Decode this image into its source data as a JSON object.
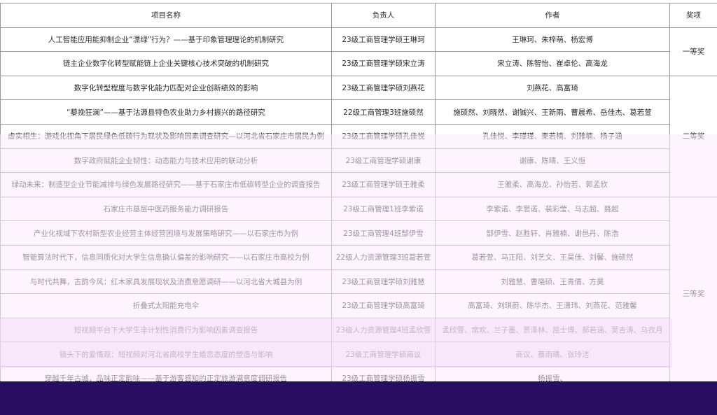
{
  "table": {
    "headers": {
      "name": "项目名称",
      "leader": "负责人",
      "authors": "作者",
      "award": "奖项"
    },
    "award_labels": {
      "first": "一等奖",
      "second": "二等奖",
      "third": "三等奖"
    },
    "rows": [
      {
        "name": "人工智能应用能抑制企业“漂绿”行为？——基于印象管理理论的机制研究",
        "leader": "23级工商管理学硕王琳珂",
        "authors": "王琳珂、朱梓萌、杨宏博"
      },
      {
        "name": "链主企业数字化转型赋能链上企业关键核心技术突破的机制研究",
        "leader": "23级工商管理学硕宋立涛",
        "authors": "宋立涛、陈智怡、崔卓伦、高海龙"
      },
      {
        "name": "数字化转型程度与数字化能力匹配对企业创新绩效的影响",
        "leader": "23级工商管理学硕刘燕花",
        "authors": "刘燕花、高富琦"
      },
      {
        "name": "“藜挽狂澜”——基于沽源县特色农业助力乡村振兴的路径研究",
        "leader": "22级工商管理3班施硕然",
        "authors": "施硕然、刘晓然、谢铖兴、王新雨、曹晨希、岳佳杰、葛若萱"
      },
      {
        "name": "虚实相生：游戏化视角下居民绿色低碳行为现状及影响因素调查研究—以河北省石家庄市居民为例",
        "leader": "23级工商管理学硕孔佳悦",
        "authors": "孔佳悦、李瑾瑾、栗若楠、刘雅楠、杨子涵"
      },
      {
        "name": "数字政府赋能企业韧性：动态能力与技术应用的联动分析",
        "leader": "23级工商管理学硕谢康",
        "authors": "谢康、陈晴、王义恒"
      },
      {
        "name": "绿动未来：制造型企业节能减排与绿色发展路径研究——基于石家庄市低碳转型企业的调查报告",
        "leader": "23级工商管理学硕王雅柔",
        "authors": "王雅柔、高海龙、孙怡若、郭孟欣"
      },
      {
        "name": "石家庄市基层中医药服务能力调研报告",
        "leader": "23级工商管理1班李紫诺",
        "authors": "李紫诺、李思诺、裴彩莹、马志超、聂超"
      },
      {
        "name": "产业化视域下农村新型农业经营主体经营困境与发展策略研究——以石家庄市为例",
        "leader": "23级工商管理4班郜伊雪",
        "authors": "郜伊雪、赵胜轩、肖雅楠、谢邑丹、陈浩"
      },
      {
        "name": "智能算法时代下，信息同质化对大学生信息确认偏差的影响研究——以石家庄市高校为例",
        "leader": "22级人力资源管理3班葛若萱",
        "authors": "葛若萱、马正阳、刘艺文、王昊佳、刘馨、施硕然"
      },
      {
        "name": "与时代共舞，古韵今风：红木家具发展现状及消费意愿调研——以河北省大城县为例",
        "leader": "23级工商管理学硕刘雅慧",
        "authors": "刘雅慧、曹晓硕、王青倩、方昊"
      },
      {
        "name": "折叠式太阳能充电伞",
        "leader": "23级工商管理学硕高富琦",
        "authors": "高富琦、刘琪蔚、陈华杰、王潇玮、刘燕花、范雅馨"
      },
      {
        "name": "短视频平台下大学生非计划性消费行为影响因素调查报告",
        "leader": "23级人力资源管理4班孟欣雪",
        "authors": "孟欣雪、席欢、兰子墨、贾泽林、屈士博、郝若涵、吴吉涛、马孜月"
      },
      {
        "name": "镜头下的爱情观：短视频对河北省高校学生婚恋态度的塑造与影响",
        "leader": "23级工商管理学硕商议",
        "authors": "商议、蔡雨晴、张玲洁"
      },
      {
        "name": "穿越千年古城，品味正定韵味——基于游客感知的正定旅游满意度调研报告",
        "leader": "23级工商管理学硕杨振雪",
        "authors": "杨振雪、"
      }
    ]
  }
}
